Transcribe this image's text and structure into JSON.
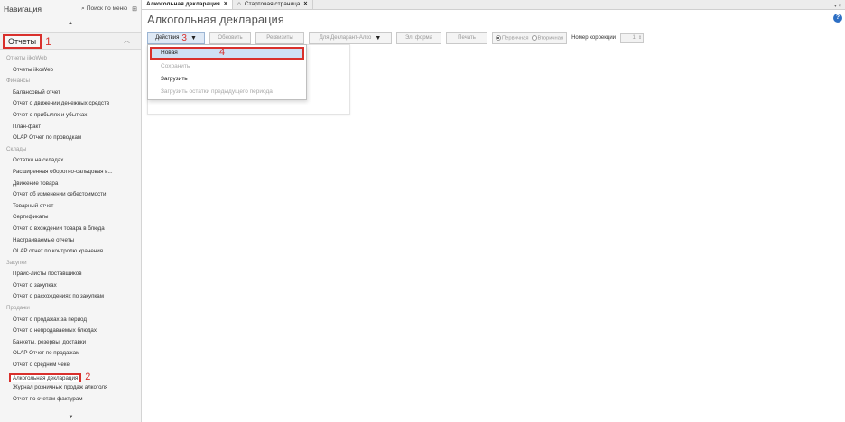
{
  "sidebar": {
    "title": "Навигация",
    "search_label": "Поиск по меню",
    "pin_icon": "pin-icon",
    "category": {
      "label": "Отчеты",
      "step": "1"
    },
    "tree": [
      {
        "type": "group",
        "label": "Отчеты iikoWeb"
      },
      {
        "type": "item",
        "label": "Отчеты iikoWeb"
      },
      {
        "type": "group",
        "label": "Финансы"
      },
      {
        "type": "item",
        "label": "Балансовый отчет"
      },
      {
        "type": "item",
        "label": "Отчет о движении денежных средств"
      },
      {
        "type": "item",
        "label": "Отчет о прибылях и убытках"
      },
      {
        "type": "item",
        "label": "План-факт"
      },
      {
        "type": "item",
        "label": "OLAP Отчет по проводкам"
      },
      {
        "type": "group",
        "label": "Склады"
      },
      {
        "type": "item",
        "label": "Остатки на складах"
      },
      {
        "type": "item",
        "label": "Расширенная оборотно-сальдовая в..."
      },
      {
        "type": "item",
        "label": "Движение товара"
      },
      {
        "type": "item",
        "label": "Отчет об изменении себестоимости"
      },
      {
        "type": "item",
        "label": "Товарный отчет"
      },
      {
        "type": "item",
        "label": "Сертификаты"
      },
      {
        "type": "item",
        "label": "Отчет о вхождении товара в блюда"
      },
      {
        "type": "item",
        "label": "Настраиваемые отчеты"
      },
      {
        "type": "item",
        "label": "OLAP отчет по контролю хранения"
      },
      {
        "type": "group",
        "label": "Закупки"
      },
      {
        "type": "item",
        "label": "Прайс-листы поставщиков"
      },
      {
        "type": "item",
        "label": "Отчет о закупках"
      },
      {
        "type": "item",
        "label": "Отчет о расхождениях по закупкам"
      },
      {
        "type": "group",
        "label": "Продажи"
      },
      {
        "type": "item",
        "label": "Отчет о продажах за период"
      },
      {
        "type": "item",
        "label": "Отчет о непродаваемых блюдах"
      },
      {
        "type": "item",
        "label": "Банкеты, резервы, доставки"
      },
      {
        "type": "item",
        "label": "OLAP Отчет по продажам"
      },
      {
        "type": "item",
        "label": "Отчет о среднем чеке"
      },
      {
        "type": "item",
        "label": "Алкогольная декларация",
        "selected": true,
        "step": "2"
      },
      {
        "type": "item",
        "label": "Журнал розничных продаж алкоголя"
      },
      {
        "type": "item",
        "label": "Отчет по счетам-фактурам"
      }
    ]
  },
  "tabs": [
    {
      "label": "Алкогольная декларация",
      "active": true
    },
    {
      "label": "Стартовая страница",
      "active": false
    }
  ],
  "tabbar_right": "▾ ×",
  "page_title": "Алкогольная декларация",
  "toolbar": {
    "actions_label": "Действия",
    "actions_step": "3",
    "refresh_label": "Обновить",
    "requisites_label": "Реквизиты",
    "declarant_label": "Для Декларант-Алко",
    "eform_label": "Эл. форма",
    "print_label": "Печать",
    "primary_label": "Первичная",
    "secondary_label": "Вторичная",
    "correction_label": "Номер коррекции",
    "correction_value": "1"
  },
  "menu": {
    "new_label": "Новая",
    "new_step": "4",
    "save_label": "Сохранить",
    "load_label": "Загрузить",
    "load_prev_label": "Загрузить остатки предыдущего периода"
  },
  "colors": {
    "annotation": "#d9302c",
    "accent": "#2d6fc4"
  }
}
